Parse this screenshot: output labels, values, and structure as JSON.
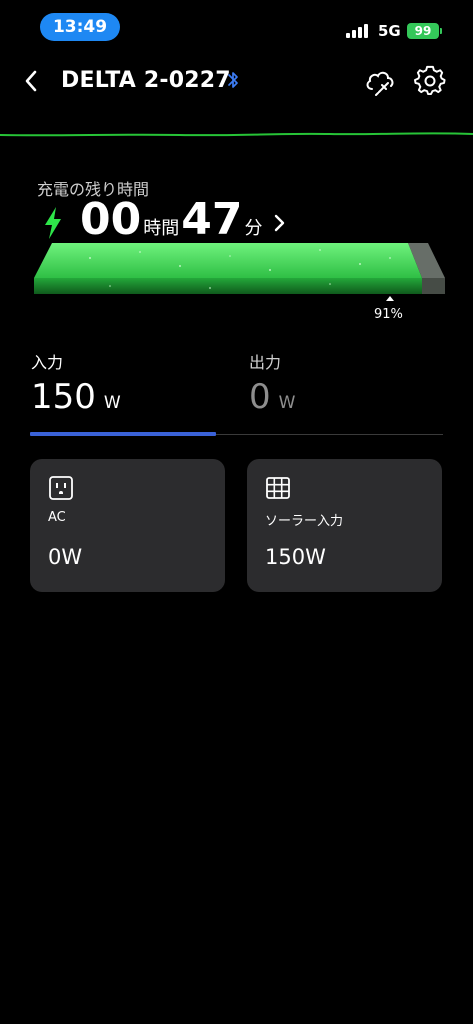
{
  "status_bar": {
    "time": "13:49",
    "network": "5G",
    "battery_level": "99"
  },
  "header": {
    "title": "DELTA 2-0227",
    "icons": [
      "chevron-left-icon",
      "bluetooth-icon",
      "cloud-plug-icon",
      "gear-icon"
    ]
  },
  "charge": {
    "label": "充電の残り時間",
    "hours": "00",
    "hours_unit": "時間",
    "minutes": "47",
    "minutes_unit": "分",
    "battery_percent": "91%",
    "battery_fraction": 0.91,
    "accent_color": "#2ee64a"
  },
  "io_tabs": [
    {
      "label": "入力",
      "value": "150",
      "unit": "W",
      "selected": true
    },
    {
      "label": "出力",
      "value": "0",
      "unit": "W",
      "selected": false
    }
  ],
  "cards": [
    {
      "icon": "ac-outlet-icon",
      "label": "AC",
      "value": "0W"
    },
    {
      "icon": "solar-panel-icon",
      "label": "ソーラー入力",
      "value": "150W"
    }
  ],
  "colors": {
    "tab_indicator": "#3a62d8",
    "time_pill": "#1e88f3",
    "battery": "#34c759",
    "card_bg": "#2c2c2e"
  }
}
